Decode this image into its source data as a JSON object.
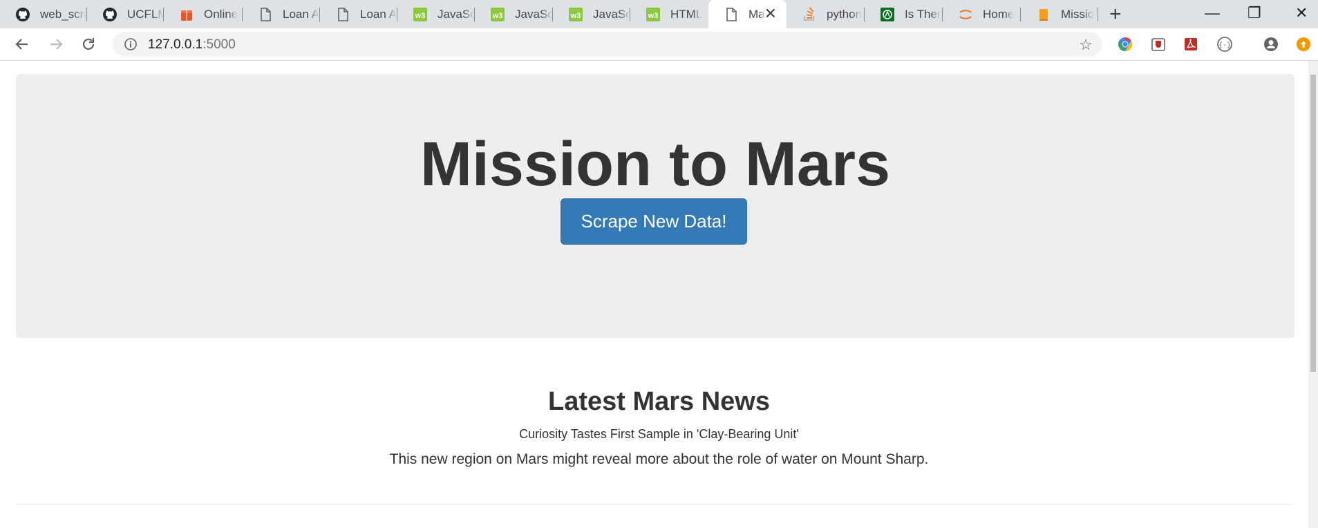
{
  "browser": {
    "tabs": [
      {
        "label": "web_scraping",
        "icon": "github-icon"
      },
      {
        "label": "UCFLM",
        "icon": "github-icon"
      },
      {
        "label": "Online",
        "icon": "gift-icon"
      },
      {
        "label": "Loan A",
        "icon": "document-icon"
      },
      {
        "label": "Loan A",
        "icon": "document-icon"
      },
      {
        "label": "JavaSc",
        "icon": "w3schools-icon"
      },
      {
        "label": "JavaSc",
        "icon": "w3schools-icon"
      },
      {
        "label": "JavaSc",
        "icon": "w3schools-icon"
      },
      {
        "label": "HTML",
        "icon": "w3schools-icon"
      },
      {
        "label": "Ma",
        "icon": "document-icon",
        "active": true
      },
      {
        "label": "python",
        "icon": "stackoverflow-icon"
      },
      {
        "label": "Is Ther",
        "icon": "codeforum-icon"
      },
      {
        "label": "Home",
        "icon": "jupyter-icon"
      },
      {
        "label": "Missio",
        "icon": "book-icon"
      }
    ],
    "close_tab": "✕",
    "new_tab": "+",
    "window_controls": {
      "minimize": "—",
      "restore": "❐",
      "close": "✕"
    },
    "address": {
      "host": "127.0.0.1",
      "port": ":5000"
    },
    "bookmark_star": "☆"
  },
  "page": {
    "title": "Mission to Mars",
    "scrape_button": "Scrape New Data!",
    "news": {
      "heading": "Latest Mars News",
      "headline": "Curiosity Tastes First Sample in 'Clay-Bearing Unit'",
      "teaser": "This new region on Mars might reveal more about the role of water on Mount Sharp."
    }
  },
  "colors": {
    "primary_button": "#337ab7",
    "jumbotron_bg": "#eeeeee",
    "tabstrip_bg": "#dee1e6"
  }
}
